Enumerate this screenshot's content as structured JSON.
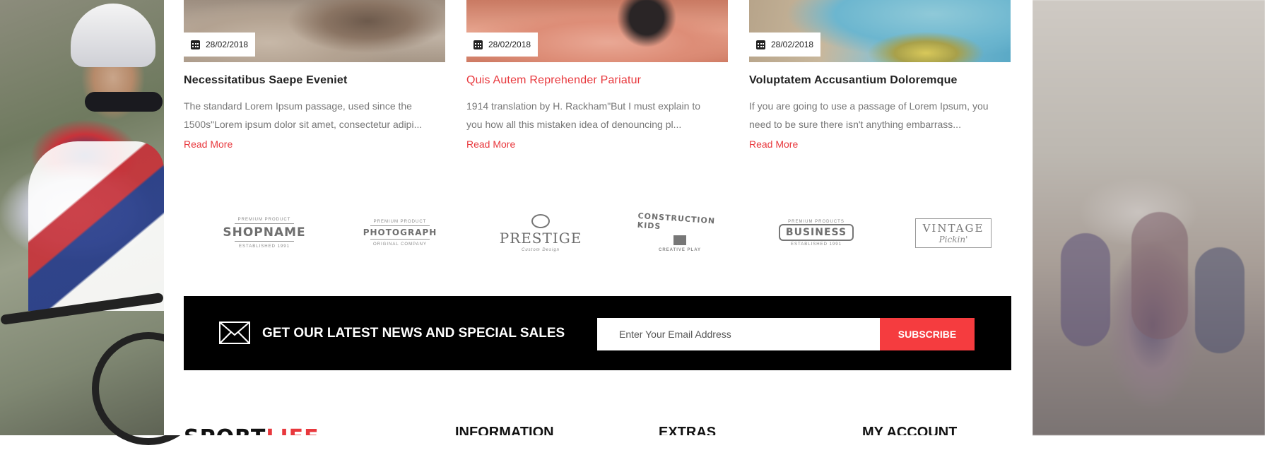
{
  "posts": [
    {
      "date": "28/02/2018",
      "title": "Necessitatibus Saepe Eveniet",
      "excerpt_line1": "The standard Lorem Ipsum passage, used since the",
      "excerpt_line2": "1500s\"Lorem ipsum dolor sit amet, consectetur adipi...",
      "read_more": "Read More"
    },
    {
      "date": "28/02/2018",
      "title": "Quis Autem Reprehender Pariatur",
      "excerpt_line1": "1914 translation by H. Rackham\"But I must explain to",
      "excerpt_line2": "you how all this mistaken idea of denouncing pl...",
      "read_more": "Read More"
    },
    {
      "date": "28/02/2018",
      "title": "Voluptatem Accusantium Doloremque",
      "excerpt_line1": "If you are going to use a passage of Lorem Ipsum, you",
      "excerpt_line2": "need to be sure there isn't anything embarrass...",
      "read_more": "Read More"
    }
  ],
  "brands": [
    {
      "top": "PREMIUM PRODUCT",
      "main": "SHOPNAME",
      "sub": "ESTABLISHED 1991"
    },
    {
      "top": "PREMIUM PRODUCT",
      "main": "PHOTOGRAPH",
      "sub": "ORIGINAL COMPANY"
    },
    {
      "top": "",
      "main": "PRESTIGE",
      "sub": "Custom Design"
    },
    {
      "top": "",
      "main": "CONSTRUCTION KIDS",
      "sub": "CREATIVE PLAY"
    },
    {
      "top": "PREMIUM PRODUCTS",
      "main": "BUSINESS",
      "sub": "ESTABLISHED 1991"
    },
    {
      "top": "",
      "main": "VINTAGE",
      "sub": "Pickin'"
    }
  ],
  "newsletter": {
    "title": "GET OUR LATEST NEWS AND SPECIAL SALES",
    "placeholder": "Enter Your Email Address",
    "button": "SUBSCRIBE"
  },
  "footer": {
    "logo_dark": "SPORT",
    "logo_red": "LIFE",
    "headings": [
      "INFORMATION",
      "EXTRAS",
      "MY ACCOUNT"
    ]
  },
  "colors": {
    "accent": "#f53c3f",
    "link": "#e8383d",
    "newsletter_bg": "#000000"
  }
}
